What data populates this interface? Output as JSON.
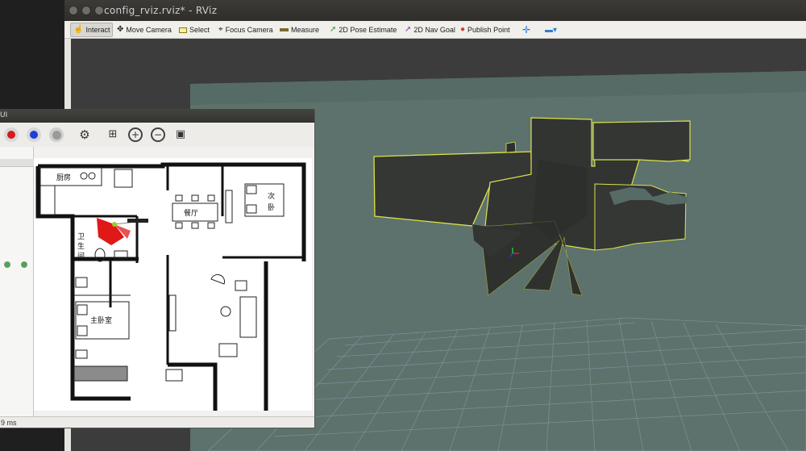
{
  "rviz": {
    "title": "config_rviz.rviz* - RViz",
    "window_buttons": [
      "×",
      "–",
      "□"
    ],
    "toolbar": {
      "interact": "Interact",
      "move_camera": "Move Camera",
      "select": "Select",
      "focus_camera": "Focus Camera",
      "measure": "Measure",
      "pose_estimate": "2D Pose Estimate",
      "nav_goal": "2D Nav Goal",
      "publish_point": "Publish Point",
      "add_glyph": "✛",
      "minus_glyph": "▬▾"
    }
  },
  "gui": {
    "title": "UI",
    "status": "9 ms",
    "rooms": {
      "kitchen": "厨房",
      "bathroom_1": "卫",
      "bathroom_2": "生",
      "bathroom_3": "间",
      "dining": "餐厅",
      "second_bed_1": "次",
      "second_bed_2": "卧",
      "master_bed": "主卧室"
    }
  },
  "colors": {
    "grid_plane": "#5d726c",
    "map_dark": "#343634",
    "map_edge": "#d9e34a",
    "laser_red": "#e01818",
    "toolbar_bg": "#f0efec"
  }
}
